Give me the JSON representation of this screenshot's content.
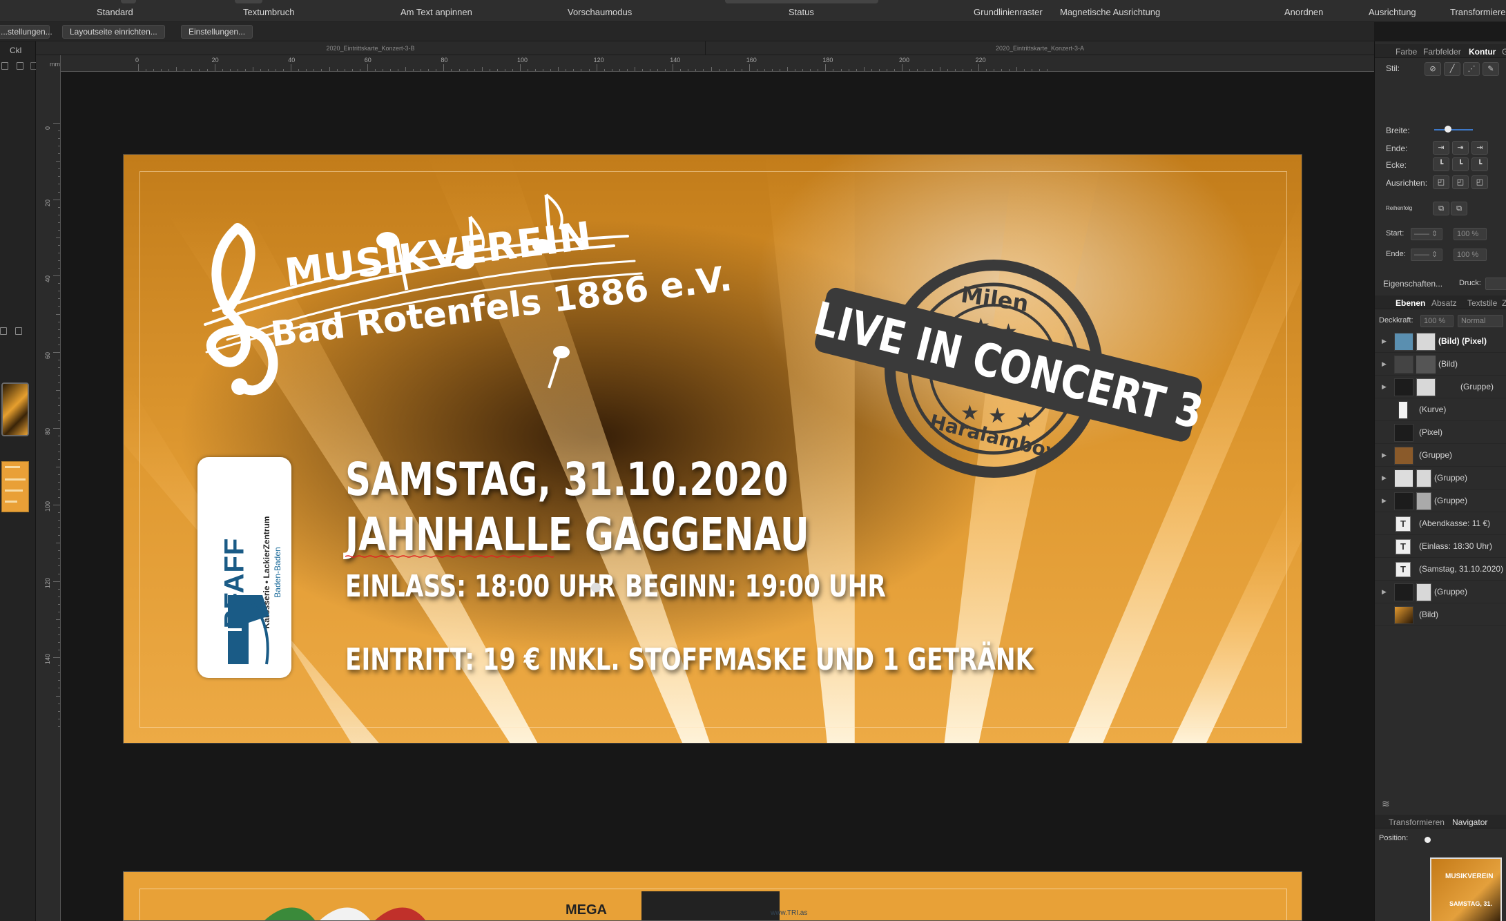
{
  "toolbar": {
    "items": [
      "Standard",
      "Textumbruch",
      "Am Text anpinnen",
      "Vorschaumodus",
      "Status",
      "Grundlinienraster",
      "Magnetische Ausrichtung",
      "Anordnen",
      "Ausrichtung",
      "Transformieren"
    ]
  },
  "contextbar": {
    "btn_settings_left": "...stellungen...",
    "btn_layout": "Layoutseite einrichten...",
    "btn_settings": "Einstellungen..."
  },
  "leftrail": {
    "label": "Ckl"
  },
  "doc_tabs": [
    "2020_Eintrittskarte_Konzert-3-B",
    "2020_Eintrittskarte_Konzert-3-A"
  ],
  "ruler": {
    "unit": "mm",
    "h_labels": [
      "0",
      "20",
      "40",
      "60",
      "80",
      "100",
      "120",
      "140",
      "160",
      "180",
      "200",
      "220"
    ],
    "v_labels": [
      "0",
      "20",
      "40",
      "60",
      "80",
      "100",
      "120",
      "140"
    ]
  },
  "ticket": {
    "logo_line1": "MUSIKVEREIN",
    "logo_line2": "Bad Rotenfels 1886 e.V.",
    "sponsor_name": "PFAFF",
    "sponsor_sub1": "Karosserie • LackierZentrum",
    "sponsor_sub2": "Baden-Baden",
    "date": "SAMSTAG, 31.10.2020",
    "venue": "JAHNHALLE GAGGENAU",
    "einlass": "EINLASS: 18:00 UHR",
    "beginn": "BEGINN: 19:00 UHR",
    "eintritt": "EINTRITT: 19 € INKL. STOFFMASKE UND 1 GETRÄNK",
    "stamp_top": "Milen",
    "stamp_band": "LIVE IN CONCERT 3",
    "stamp_bottom": "Haralambov"
  },
  "ticket2": {
    "brand": "MEGA",
    "web": "www.TRI.as"
  },
  "panel": {
    "tabs_top": [
      "Farbe",
      "Farbfelder",
      "Kontur",
      "G"
    ],
    "active_tab": "Kontur",
    "stil_label": "Stil:",
    "breite_label": "Breite:",
    "ende_label": "Ende:",
    "ecke_label": "Ecke:",
    "ausrichten_label": "Ausrichten:",
    "reihenfolge_label": "Reihenfolg",
    "start_label": "Start:",
    "ende2_label": "Ende:",
    "start_pct": "100 %",
    "ende_pct": "100 %",
    "eigenschaften_label": "Eigenschaften...",
    "druck_label": "Druck:",
    "tabs_layers": [
      "Ebenen",
      "Absatz",
      "Textstile",
      "Z"
    ],
    "active_layers_tab": "Ebenen",
    "deckkraft_label": "Deckkraft:",
    "deckkraft_value": "100 %",
    "blend_mode": "Normal",
    "layers": [
      {
        "name": "(Bild) (Pixel)",
        "kind": "image",
        "expand": true,
        "selected": true
      },
      {
        "name": "(Bild)",
        "kind": "image",
        "expand": true
      },
      {
        "name": "(Gruppe)",
        "kind": "group",
        "expand": true
      },
      {
        "name": "(Kurve)",
        "kind": "curve",
        "expand": false
      },
      {
        "name": "(Pixel)",
        "kind": "pixel",
        "expand": false
      },
      {
        "name": "(Gruppe)",
        "kind": "group",
        "expand": true
      },
      {
        "name": "(Gruppe)",
        "kind": "group",
        "expand": true
      },
      {
        "name": "(Gruppe)",
        "kind": "group",
        "expand": true
      },
      {
        "name": "(Abendkasse: 11 €)",
        "kind": "text",
        "expand": false
      },
      {
        "name": "(Einlass: 18:30 Uhr)",
        "kind": "text",
        "expand": false
      },
      {
        "name": "(Samstag, 31.10.2020)",
        "kind": "text",
        "expand": false
      },
      {
        "name": "(Gruppe)",
        "kind": "group",
        "expand": true
      },
      {
        "name": "(Bild)",
        "kind": "image",
        "expand": false
      }
    ],
    "tabs_bottom": [
      "Transformieren",
      "Navigator"
    ],
    "active_bottom_tab": "Navigator",
    "position_label": "Position:",
    "nav_thumb_text1": "MUSIKVEREIN",
    "nav_thumb_text2": "SAMSTAG, 31."
  },
  "colors": {
    "accent_blue": "#3d78c8",
    "ticket_orange": "#e09a32",
    "ticket_dark": "#2a1604",
    "sponsor_blue": "#1a5b86",
    "stamp_gray": "#3a3a3a"
  }
}
